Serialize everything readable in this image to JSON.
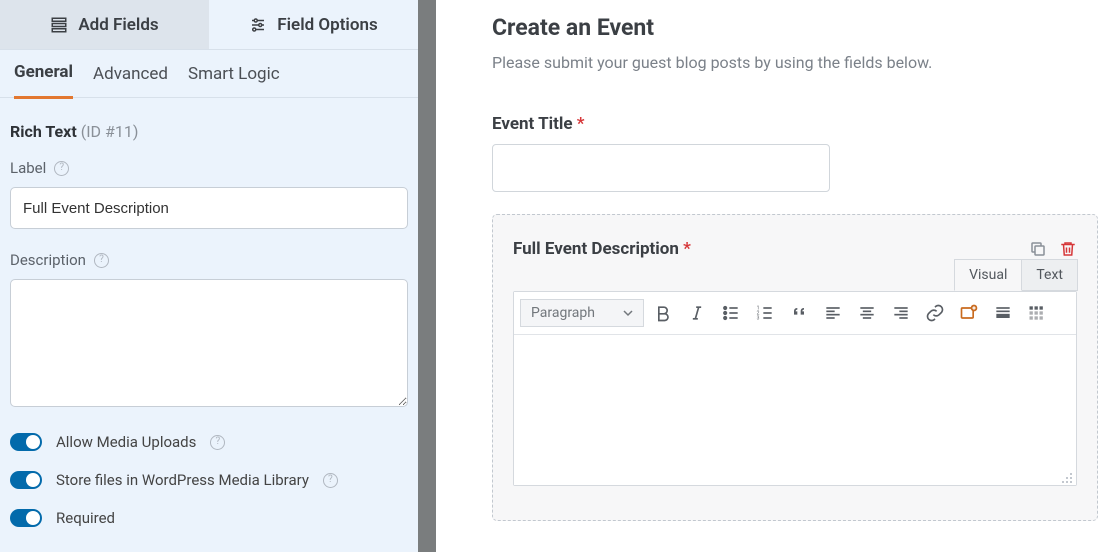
{
  "sidebar": {
    "topTabs": {
      "addFields": "Add Fields",
      "fieldOptions": "Field Options"
    },
    "subTabs": {
      "general": "General",
      "advanced": "Advanced",
      "smartLogic": "Smart Logic"
    },
    "fieldHeading": {
      "type": "Rich Text",
      "idText": "(ID #11)"
    },
    "label": {
      "title": "Label",
      "value": "Full Event Description"
    },
    "description": {
      "title": "Description",
      "value": ""
    },
    "toggles": {
      "allowMedia": "Allow Media Uploads",
      "storeLibrary": "Store files in WordPress Media Library",
      "required": "Required"
    }
  },
  "preview": {
    "title": "Create an Event",
    "intro": "Please submit your guest blog posts by using the fields below.",
    "eventTitle": {
      "label": "Event Title",
      "required": "*"
    },
    "richField": {
      "label": "Full Event Description",
      "required": "*",
      "editorTabs": {
        "visual": "Visual",
        "text": "Text"
      },
      "formatSelect": "Paragraph"
    }
  }
}
